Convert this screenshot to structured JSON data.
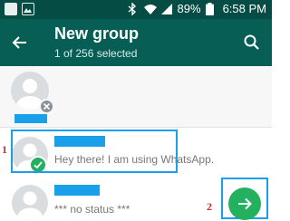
{
  "status_bar": {
    "battery": "89%",
    "time": "6:58 PM",
    "icons": [
      "notification-icon",
      "gallery-icon",
      "bluetooth-icon",
      "wifi-icon",
      "signal-icon",
      "battery-icon"
    ]
  },
  "app_bar": {
    "title": "New group",
    "subtitle": "1 of 256 selected",
    "back_icon": "back-arrow-icon",
    "search_icon": "search-icon"
  },
  "contacts": [
    {
      "status": "Hey there! I am using WhatsApp.",
      "selected": true
    },
    {
      "status": "*** no status ***",
      "selected": false
    }
  ],
  "annotations": {
    "one": "1",
    "two": "2"
  },
  "fab": {
    "icon": "forward-arrow-icon"
  },
  "colors": {
    "status_bar": "#054d44",
    "app_bar": "#075e54",
    "accent_green": "#23b05f",
    "annotation_blue": "#1aa0ea",
    "annotation_red": "#d42a2a"
  }
}
